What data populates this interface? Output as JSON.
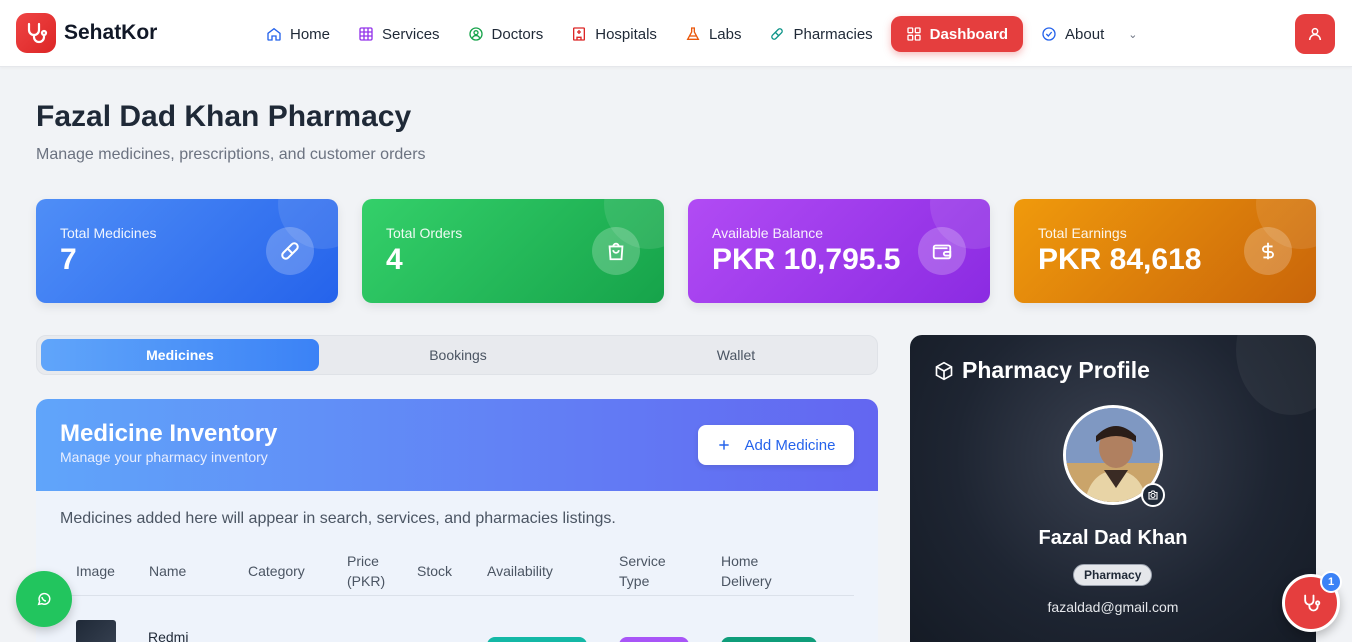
{
  "brand": {
    "name": "SehatKor"
  },
  "nav": {
    "items": [
      {
        "label": "Home",
        "icon": "home-icon"
      },
      {
        "label": "Services",
        "icon": "grid-icon"
      },
      {
        "label": "Doctors",
        "icon": "doctor-icon"
      },
      {
        "label": "Hospitals",
        "icon": "hospital-icon"
      },
      {
        "label": "Labs",
        "icon": "flask-icon"
      },
      {
        "label": "Pharmacies",
        "icon": "pill-icon"
      },
      {
        "label": "Dashboard",
        "icon": "dashboard-icon",
        "active": true
      },
      {
        "label": "About",
        "icon": "about-icon"
      }
    ],
    "more_icon": "chevron-down-icon"
  },
  "header": {
    "title": "Fazal Dad Khan Pharmacy",
    "subtitle": "Manage medicines, prescriptions, and customer orders"
  },
  "stats": [
    {
      "label": "Total Medicines",
      "value": "7",
      "icon": "pill-icon"
    },
    {
      "label": "Total Orders",
      "value": "4",
      "icon": "shopping-bag-icon"
    },
    {
      "label": "Available Balance",
      "value": "PKR 10,795.5",
      "icon": "wallet-icon"
    },
    {
      "label": "Total Earnings",
      "value": "PKR 84,618",
      "icon": "dollar-icon"
    }
  ],
  "tabs": [
    {
      "label": "Medicines",
      "active": true
    },
    {
      "label": "Bookings"
    },
    {
      "label": "Wallet"
    }
  ],
  "inventory": {
    "title": "Medicine Inventory",
    "subtitle": "Manage your pharmacy inventory",
    "add_label": "Add Medicine",
    "note": "Medicines added here will appear in search, services, and pharmacies listings.",
    "columns": [
      "Image",
      "Name",
      "Category",
      "Price (PKR)",
      "Stock",
      "Availability",
      "Service Type",
      "Home Delivery"
    ],
    "rows": [
      {
        "name": "Redmi"
      }
    ]
  },
  "profile": {
    "title": "Pharmacy Profile",
    "name": "Fazal Dad Khan",
    "badge": "Pharmacy",
    "email": "fazaldad@gmail.com"
  },
  "floating": {
    "notification_count": "1"
  },
  "colors": {
    "accent_red": "#e53e3e",
    "blue": "#2563eb",
    "green": "#16a34a",
    "purple": "#8b2be2",
    "orange": "#c9650a"
  }
}
